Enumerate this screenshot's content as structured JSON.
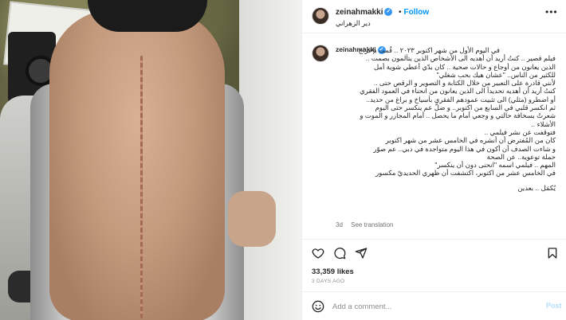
{
  "post": {
    "username": "zeinahmakki",
    "verified_badge": "✓",
    "separator": "•",
    "follow_label": "Follow",
    "location": "دير الزهراني",
    "more_label": "•••"
  },
  "caption": {
    "username": "zeinahmakki",
    "lines": [
      "في اليوم الأول من شهر اكتوبر ٢٠٢٣ .. قُمت بإخراج",
      "فيلم قصير .. كنتُ أريد أن أهديه الى الأشخاص الذين يتألمون بصمت ..",
      "الذين يعانون من أوجاع و حالات صحية .. كان بدّي أعطي شوية أمل",
      "للكثير من الناس.. \"عشان هيك بحب شغلي\"",
      "لأنني قادرة على التعبير من خلال الكتابة و التصوير و الرقص حتى ..",
      "كنتُ أريد أن أهديه تحديداً الى الذين يعانون من انحناء في العمود الفقري",
      "أو اضطرو (مثلي) الى تثبيت عمودهم الفقري بأسياخ و براغ من حديد..",
      "ثم انكسر قلبي في السابع من اكتوبر.. و ضلّ عم ينكسر حتى اليوم",
      "شعرتُ بسخافة حالتي و وجعي أمام ما يحصل .. أمام المجازر و الموت و",
      "الأشلاء ..",
      "فتوقفت عن نشر فيلمي ..",
      "كان من المُفترض أن أنشره في الخامس عشر من شهر اكتوبر",
      "و شاءت الصدف أن أكون في هذا اليوم متواجدة في دبي.. عم صوّر",
      "حملة توعوية.. عن الصحة",
      "المهم .. فيلمي اسمه \"انحنى دون أن ينكسر\"",
      "في الخامس عشر من اكتوبر، اكتشفت أن ظهري الحديديّ مكسور",
      "",
      "يُكمَل .. بعدين"
    ],
    "age": "3d",
    "see_translation": "See translation"
  },
  "actions": {
    "like_icon": "heart-icon",
    "comment_icon": "comment-icon",
    "share_icon": "share-icon",
    "save_icon": "bookmark-icon"
  },
  "likes": "33,359 likes",
  "time_ago": "3 DAYS AGO",
  "comment_box": {
    "placeholder": "Add a comment...",
    "post_label": "Post"
  },
  "colors": {
    "follow": "#0095f6",
    "verified": "#3897f0",
    "post_disabled": "#b2dffc"
  }
}
